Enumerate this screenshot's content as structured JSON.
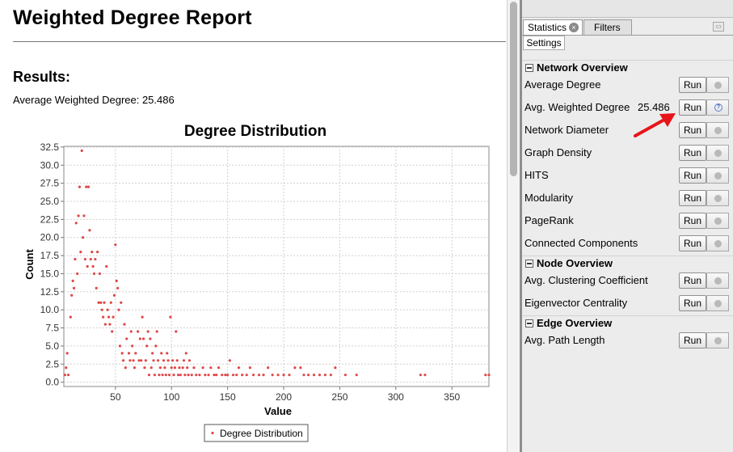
{
  "report": {
    "title": "Weighted Degree Report",
    "results_heading": "Results:",
    "avg_weighted_degree_line": "Average Weighted Degree: 25.486"
  },
  "chart_data": {
    "type": "scatter",
    "title": "Degree Distribution",
    "xlabel": "Value",
    "ylabel": "Count",
    "xlim": [
      4,
      383
    ],
    "ylim": [
      -0.6,
      32.6
    ],
    "xticks": [
      50,
      100,
      150,
      200,
      250,
      300,
      350
    ],
    "yticks": [
      0.0,
      2.5,
      5.0,
      7.5,
      10.0,
      12.5,
      15.0,
      17.5,
      20.0,
      22.5,
      25.0,
      27.5,
      30.0,
      32.5
    ],
    "grid": true,
    "legend": "bottom-center",
    "series": [
      {
        "name": "Degree Distribution",
        "color": "#e04848",
        "points": [
          [
            5,
            1
          ],
          [
            6,
            2
          ],
          [
            7,
            4
          ],
          [
            8,
            1
          ],
          [
            10,
            9
          ],
          [
            11,
            12
          ],
          [
            12,
            14
          ],
          [
            13,
            13
          ],
          [
            14,
            17
          ],
          [
            15,
            22
          ],
          [
            16,
            15
          ],
          [
            17,
            23
          ],
          [
            18,
            27
          ],
          [
            19,
            18
          ],
          [
            20,
            32
          ],
          [
            21,
            20
          ],
          [
            22,
            23
          ],
          [
            23,
            17
          ],
          [
            24,
            27
          ],
          [
            25,
            16
          ],
          [
            26,
            27
          ],
          [
            27,
            21
          ],
          [
            28,
            17
          ],
          [
            29,
            18
          ],
          [
            30,
            16
          ],
          [
            31,
            15
          ],
          [
            32,
            17
          ],
          [
            33,
            13
          ],
          [
            34,
            18
          ],
          [
            35,
            11
          ],
          [
            36,
            15
          ],
          [
            37,
            11
          ],
          [
            38,
            10
          ],
          [
            39,
            9
          ],
          [
            40,
            11
          ],
          [
            41,
            8
          ],
          [
            42,
            16
          ],
          [
            43,
            10
          ],
          [
            44,
            9
          ],
          [
            45,
            8
          ],
          [
            46,
            11
          ],
          [
            47,
            7
          ],
          [
            48,
            9
          ],
          [
            49,
            12
          ],
          [
            50,
            19
          ],
          [
            51,
            14
          ],
          [
            52,
            13
          ],
          [
            53,
            10
          ],
          [
            54,
            5
          ],
          [
            55,
            11
          ],
          [
            56,
            4
          ],
          [
            57,
            3
          ],
          [
            58,
            8
          ],
          [
            59,
            2
          ],
          [
            60,
            6
          ],
          [
            62,
            4
          ],
          [
            63,
            3
          ],
          [
            64,
            7
          ],
          [
            65,
            5
          ],
          [
            66,
            3
          ],
          [
            67,
            2
          ],
          [
            68,
            4
          ],
          [
            70,
            7
          ],
          [
            71,
            3
          ],
          [
            72,
            6
          ],
          [
            73,
            3
          ],
          [
            74,
            9
          ],
          [
            75,
            6
          ],
          [
            76,
            2
          ],
          [
            77,
            3
          ],
          [
            78,
            5
          ],
          [
            79,
            7
          ],
          [
            80,
            1
          ],
          [
            81,
            6
          ],
          [
            82,
            2
          ],
          [
            83,
            4
          ],
          [
            84,
            3
          ],
          [
            85,
            1
          ],
          [
            86,
            5
          ],
          [
            87,
            7
          ],
          [
            88,
            3
          ],
          [
            89,
            1
          ],
          [
            90,
            2
          ],
          [
            91,
            4
          ],
          [
            92,
            1
          ],
          [
            93,
            3
          ],
          [
            94,
            2
          ],
          [
            95,
            1
          ],
          [
            96,
            4
          ],
          [
            97,
            3
          ],
          [
            98,
            1
          ],
          [
            99,
            9
          ],
          [
            100,
            2
          ],
          [
            101,
            3
          ],
          [
            102,
            1
          ],
          [
            103,
            2
          ],
          [
            104,
            7
          ],
          [
            105,
            3
          ],
          [
            106,
            1
          ],
          [
            107,
            2
          ],
          [
            108,
            1
          ],
          [
            110,
            2
          ],
          [
            111,
            3
          ],
          [
            112,
            1
          ],
          [
            113,
            4
          ],
          [
            114,
            2
          ],
          [
            115,
            1
          ],
          [
            116,
            3
          ],
          [
            118,
            1
          ],
          [
            120,
            2
          ],
          [
            122,
            1
          ],
          [
            125,
            1
          ],
          [
            128,
            2
          ],
          [
            130,
            1
          ],
          [
            133,
            1
          ],
          [
            135,
            2
          ],
          [
            138,
            1
          ],
          [
            140,
            1
          ],
          [
            142,
            2
          ],
          [
            145,
            1
          ],
          [
            148,
            1
          ],
          [
            150,
            1
          ],
          [
            152,
            3
          ],
          [
            155,
            1
          ],
          [
            158,
            1
          ],
          [
            160,
            2
          ],
          [
            163,
            1
          ],
          [
            167,
            1
          ],
          [
            170,
            2
          ],
          [
            173,
            1
          ],
          [
            178,
            1
          ],
          [
            182,
            1
          ],
          [
            186,
            2
          ],
          [
            190,
            1
          ],
          [
            195,
            1
          ],
          [
            200,
            1
          ],
          [
            205,
            1
          ],
          [
            210,
            2
          ],
          [
            215,
            2
          ],
          [
            218,
            1
          ],
          [
            222,
            1
          ],
          [
            227,
            1
          ],
          [
            232,
            1
          ],
          [
            237,
            1
          ],
          [
            242,
            1
          ],
          [
            246,
            2
          ],
          [
            255,
            1
          ],
          [
            265,
            1
          ],
          [
            322,
            1
          ],
          [
            326,
            1
          ],
          [
            380,
            1
          ],
          [
            383,
            1
          ]
        ]
      }
    ]
  },
  "panel": {
    "tabs": [
      "Statistics",
      "Filters"
    ],
    "settings_label": "Settings",
    "run_label": "Run",
    "sections": [
      {
        "title": "Network Overview",
        "rows": [
          {
            "label": "Average Degree",
            "value": "",
            "status": "dot"
          },
          {
            "label": "Avg. Weighted Degree",
            "value": "25.486",
            "status": "help"
          },
          {
            "label": "Network Diameter",
            "value": "",
            "status": "dot"
          },
          {
            "label": "Graph Density",
            "value": "",
            "status": "dot"
          },
          {
            "label": "HITS",
            "value": "",
            "status": "dot"
          },
          {
            "label": "Modularity",
            "value": "",
            "status": "dot"
          },
          {
            "label": "PageRank",
            "value": "",
            "status": "dot"
          },
          {
            "label": "Connected Components",
            "value": "",
            "status": "dot"
          }
        ]
      },
      {
        "title": "Node Overview",
        "rows": [
          {
            "label": "Avg. Clustering Coefficient",
            "value": "",
            "status": "dot"
          },
          {
            "label": "Eigenvector Centrality",
            "value": "",
            "status": "dot"
          }
        ]
      },
      {
        "title": "Edge Overview",
        "rows": [
          {
            "label": "Avg. Path Length",
            "value": "",
            "status": "dot"
          }
        ]
      }
    ]
  },
  "colors": {
    "accent_arrow": "#e8141a",
    "point_color": "#e04848"
  },
  "icons": {
    "tab_close": "close-circle-icon",
    "minimize": "minimize-icon",
    "collapse": "collapse-minus-icon",
    "status_idle": "status-dot-icon",
    "status_help": "help-icon",
    "annotation": "red-arrow-icon"
  }
}
